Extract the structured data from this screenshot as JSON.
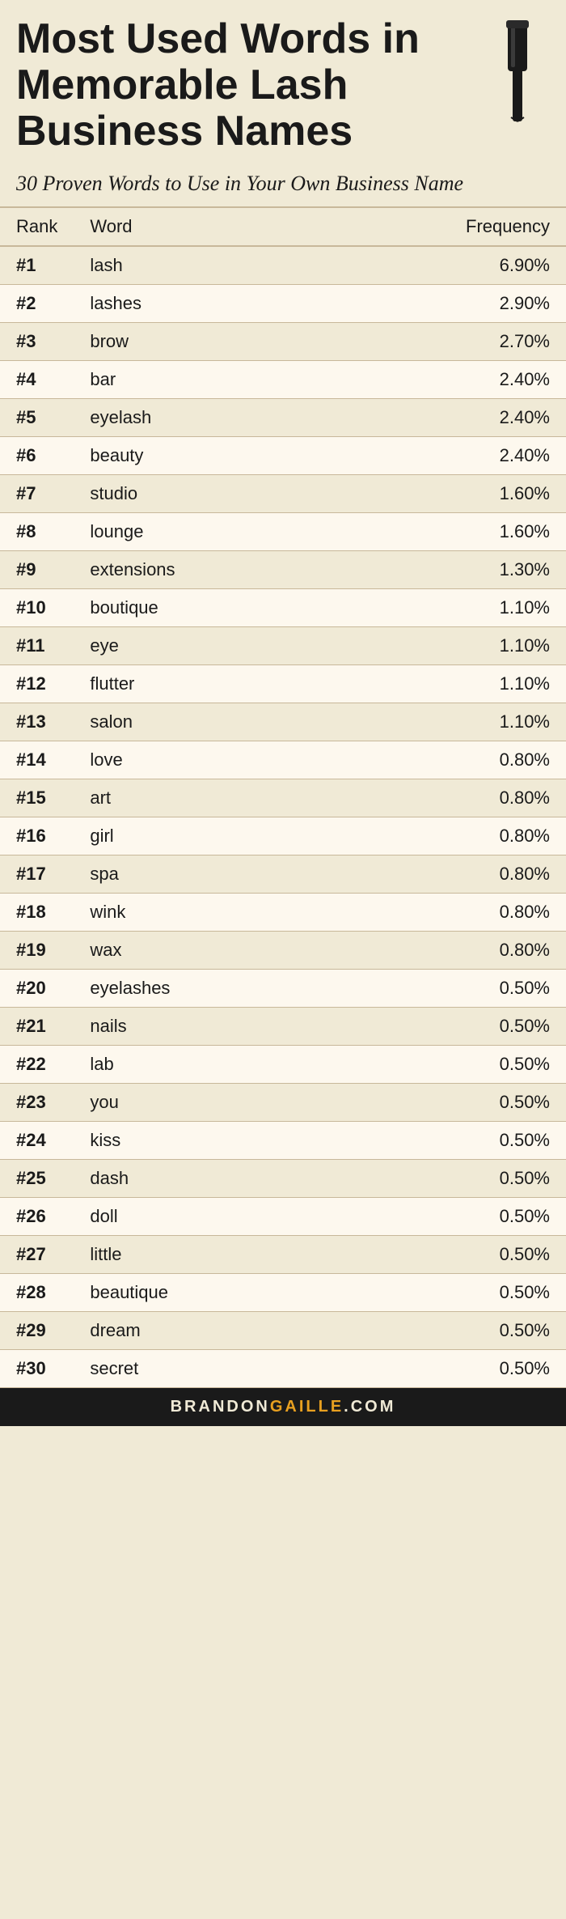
{
  "header": {
    "main_title": "Most Used Words in Memorable Lash Business Names",
    "subtitle": "30 Proven Words to Use in Your Own Business Name"
  },
  "table": {
    "columns": {
      "rank": "Rank",
      "word": "Word",
      "frequency": "Frequency"
    },
    "rows": [
      {
        "rank": "#1",
        "word": "lash",
        "frequency": "6.90%"
      },
      {
        "rank": "#2",
        "word": "lashes",
        "frequency": "2.90%"
      },
      {
        "rank": "#3",
        "word": "brow",
        "frequency": "2.70%"
      },
      {
        "rank": "#4",
        "word": "bar",
        "frequency": "2.40%"
      },
      {
        "rank": "#5",
        "word": "eyelash",
        "frequency": "2.40%"
      },
      {
        "rank": "#6",
        "word": "beauty",
        "frequency": "2.40%"
      },
      {
        "rank": "#7",
        "word": "studio",
        "frequency": "1.60%"
      },
      {
        "rank": "#8",
        "word": "lounge",
        "frequency": "1.60%"
      },
      {
        "rank": "#9",
        "word": "extensions",
        "frequency": "1.30%"
      },
      {
        "rank": "#10",
        "word": "boutique",
        "frequency": "1.10%"
      },
      {
        "rank": "#11",
        "word": "eye",
        "frequency": "1.10%"
      },
      {
        "rank": "#12",
        "word": "flutter",
        "frequency": "1.10%"
      },
      {
        "rank": "#13",
        "word": "salon",
        "frequency": "1.10%"
      },
      {
        "rank": "#14",
        "word": "love",
        "frequency": "0.80%"
      },
      {
        "rank": "#15",
        "word": "art",
        "frequency": "0.80%"
      },
      {
        "rank": "#16",
        "word": "girl",
        "frequency": "0.80%"
      },
      {
        "rank": "#17",
        "word": "spa",
        "frequency": "0.80%"
      },
      {
        "rank": "#18",
        "word": "wink",
        "frequency": "0.80%"
      },
      {
        "rank": "#19",
        "word": "wax",
        "frequency": "0.80%"
      },
      {
        "rank": "#20",
        "word": "eyelashes",
        "frequency": "0.50%"
      },
      {
        "rank": "#21",
        "word": "nails",
        "frequency": "0.50%"
      },
      {
        "rank": "#22",
        "word": "lab",
        "frequency": "0.50%"
      },
      {
        "rank": "#23",
        "word": "you",
        "frequency": "0.50%"
      },
      {
        "rank": "#24",
        "word": "kiss",
        "frequency": "0.50%"
      },
      {
        "rank": "#25",
        "word": "dash",
        "frequency": "0.50%"
      },
      {
        "rank": "#26",
        "word": "doll",
        "frequency": "0.50%"
      },
      {
        "rank": "#27",
        "word": "little",
        "frequency": "0.50%"
      },
      {
        "rank": "#28",
        "word": "beautique",
        "frequency": "0.50%"
      },
      {
        "rank": "#29",
        "word": "dream",
        "frequency": "0.50%"
      },
      {
        "rank": "#30",
        "word": "secret",
        "frequency": "0.50%"
      }
    ]
  },
  "footer": {
    "brand_parts": [
      {
        "text": "BRANDON",
        "color": "light"
      },
      {
        "text": "GAILLE",
        "color": "accent"
      },
      {
        "text": ".COM",
        "color": "light"
      }
    ],
    "full_text": "BRANDONGAILLE.COM",
    "brand": "BRANDON",
    "accent": "GAILLE",
    "suffix": ".COM"
  }
}
